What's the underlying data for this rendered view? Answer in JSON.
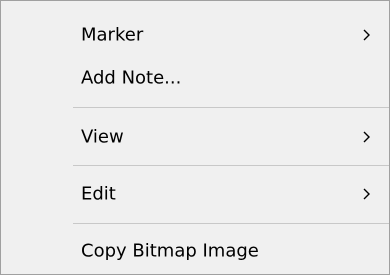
{
  "context_menu": {
    "items": [
      {
        "label": "Marker",
        "has_submenu": true
      },
      {
        "label": "Add Note..."
      },
      {
        "label": "View",
        "has_submenu": true
      },
      {
        "label": "Edit",
        "has_submenu": true
      },
      {
        "label": "Copy Bitmap Image"
      }
    ],
    "submenu_icon": "chevron-right-icon",
    "colors": {
      "background": "#f0f0f0",
      "border": "#a0a0a0",
      "separator": "#c8c8c8",
      "text": "#000000"
    }
  }
}
